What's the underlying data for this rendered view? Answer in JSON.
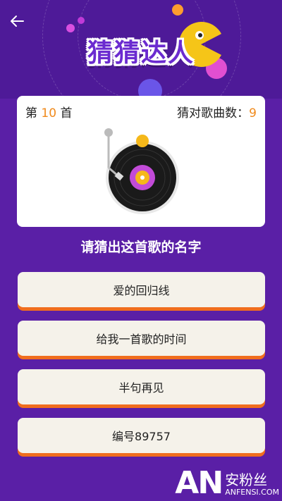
{
  "header": {
    "back_icon": "arrow-left-icon",
    "title": "猜猜达人"
  },
  "card": {
    "round_prefix": "第",
    "round_number": "10",
    "round_suffix": "首",
    "score_label": "猜对歌曲数：",
    "score_value": "9",
    "record_icon": "vinyl-record-icon"
  },
  "question": "请猜出这首歌的名字",
  "options": [
    {
      "label": "爱的回归线"
    },
    {
      "label": "给我一首歌的时间"
    },
    {
      "label": "半句再见"
    },
    {
      "label": "编号89757"
    }
  ],
  "watermark": {
    "logo": "AN",
    "cn": "安粉丝",
    "en": "ANFENSI.COM"
  },
  "colors": {
    "background": "#5a1fa6",
    "accent": "#f08a1c",
    "option_shadow": "#f06d1e"
  }
}
